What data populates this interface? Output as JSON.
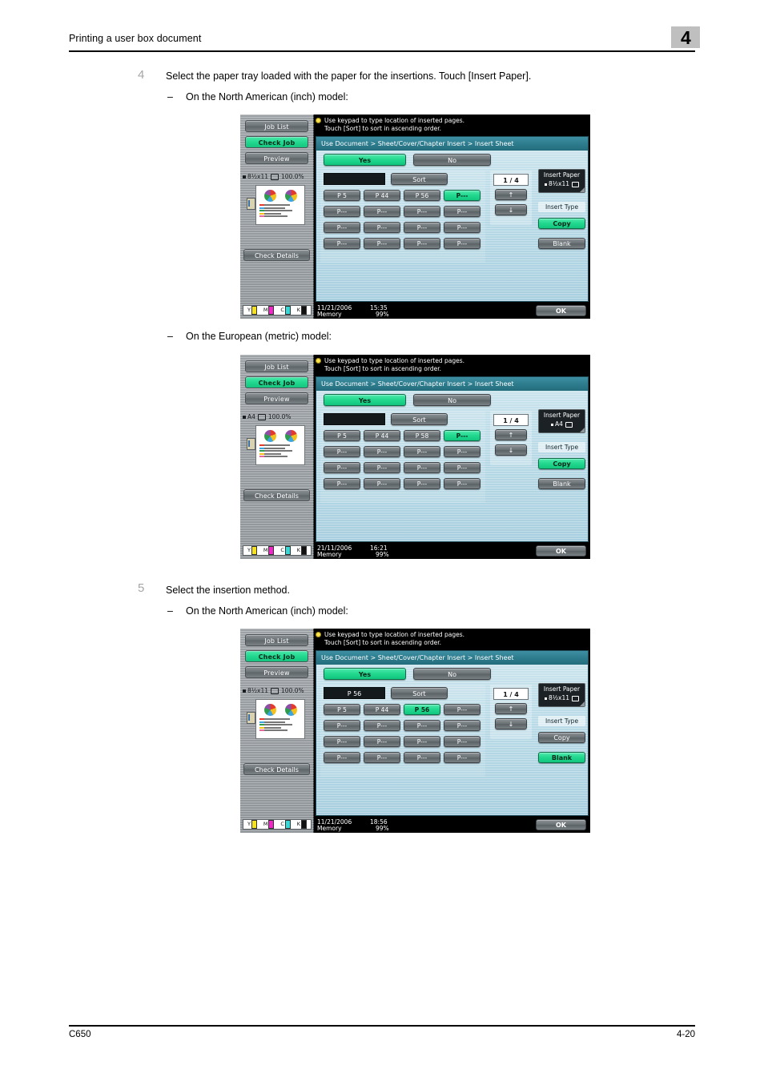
{
  "header": {
    "title": "Printing a user box document",
    "chapter": "4"
  },
  "footer": {
    "left": "C650",
    "right": "4-20"
  },
  "steps": [
    {
      "number": "4",
      "text": "Select the paper tray loaded with the paper for the insertions. Touch [Insert Paper].",
      "dash": "–",
      "caption": "On the North American (inch) model:"
    },
    {
      "dash": "–",
      "caption": "On the European (metric) model:"
    },
    {
      "number": "5",
      "text": "Select the insertion method.",
      "dash": "–",
      "caption": "On the North American (inch) model:"
    }
  ],
  "panels": [
    {
      "rail": {
        "job_list": "Job List",
        "check_job": "Check Job",
        "preview": "Preview",
        "paper_size": "8½x11",
        "zoom": "100.0%",
        "check_details": "Check Details",
        "toner": [
          "Y",
          "M",
          "C",
          "K"
        ]
      },
      "hint": "Use keypad to type location of inserted pages.\nTouch [Sort] to sort in ascending order.",
      "breadcrumb": "Use Document > Sheet/Cover/Chapter Insert > Insert Sheet",
      "yes": "Yes",
      "no": "No",
      "num_display": "",
      "sort": "Sort",
      "grid": [
        "P  5",
        "P 44",
        "P 56",
        "P---",
        "P---",
        "P---",
        "P---",
        "P---",
        "P---",
        "P---",
        "P---",
        "P---",
        "P---",
        "P---",
        "P---",
        "P---"
      ],
      "grid_active_index": 3,
      "page_indicator": "1 / 4",
      "arrow_up": "↑",
      "arrow_down": "↓",
      "insert_paper_label": "Insert Paper",
      "insert_paper_value": "8½x11",
      "insert_type_label": "Insert Type",
      "copy": "Copy",
      "blank": "Blank",
      "copy_active": true,
      "blank_active": false,
      "date": "11/21/2006",
      "time": "15:35",
      "memory_label": "Memory",
      "memory_value": "99%",
      "ok": "OK"
    },
    {
      "rail": {
        "job_list": "Job List",
        "check_job": "Check Job",
        "preview": "Preview",
        "paper_size": "A4",
        "zoom": "100.0%",
        "check_details": "Check Details",
        "toner": [
          "Y",
          "M",
          "C",
          "K"
        ]
      },
      "hint": "Use keypad to type location of inserted pages.\nTouch [Sort] to sort in ascending order.",
      "breadcrumb": "Use Document > Sheet/Cover/Chapter Insert > Insert Sheet",
      "yes": "Yes",
      "no": "No",
      "num_display": "",
      "sort": "Sort",
      "grid": [
        "P  5",
        "P 44",
        "P 58",
        "P---",
        "P---",
        "P---",
        "P---",
        "P---",
        "P---",
        "P---",
        "P---",
        "P---",
        "P---",
        "P---",
        "P---",
        "P---"
      ],
      "grid_active_index": 3,
      "page_indicator": "1 / 4",
      "arrow_up": "↑",
      "arrow_down": "↓",
      "insert_paper_label": "Insert Paper",
      "insert_paper_value": "A4",
      "insert_type_label": "Insert Type",
      "copy": "Copy",
      "blank": "Blank",
      "copy_active": true,
      "blank_active": false,
      "date": "21/11/2006",
      "time": "16:21",
      "memory_label": "Memory",
      "memory_value": "99%",
      "ok": "OK"
    },
    {
      "rail": {
        "job_list": "Job List",
        "check_job": "Check Job",
        "preview": "Preview",
        "paper_size": "8½x11",
        "zoom": "100.0%",
        "check_details": "Check Details",
        "toner": [
          "Y",
          "M",
          "C",
          "K"
        ]
      },
      "hint": "Use keypad to type location of inserted pages.\nTouch [Sort] to sort in ascending order.",
      "breadcrumb": "Use Document > Sheet/Cover/Chapter Insert > Insert Sheet",
      "yes": "Yes",
      "no": "No",
      "num_display": "P 56",
      "sort": "Sort",
      "grid": [
        "P  5",
        "P 44",
        "P 56",
        "P---",
        "P---",
        "P---",
        "P---",
        "P---",
        "P---",
        "P---",
        "P---",
        "P---",
        "P---",
        "P---",
        "P---",
        "P---"
      ],
      "grid_active_index": 2,
      "page_indicator": "1 / 4",
      "arrow_up": "↑",
      "arrow_down": "↓",
      "insert_paper_label": "Insert Paper",
      "insert_paper_value": "8½x11",
      "insert_type_label": "Insert Type",
      "copy": "Copy",
      "blank": "Blank",
      "copy_active": false,
      "blank_active": true,
      "date": "11/21/2006",
      "time": "18:56",
      "memory_label": "Memory",
      "memory_value": "99%",
      "ok": "OK"
    }
  ],
  "colors": {
    "accent_green": "#22d88f",
    "breadcrumb_teal": "#2c7b8d",
    "screen_blue": "#bcdce8",
    "badge_gray": "#bfbfbf",
    "step_number_gray": "#a6a6a6"
  }
}
